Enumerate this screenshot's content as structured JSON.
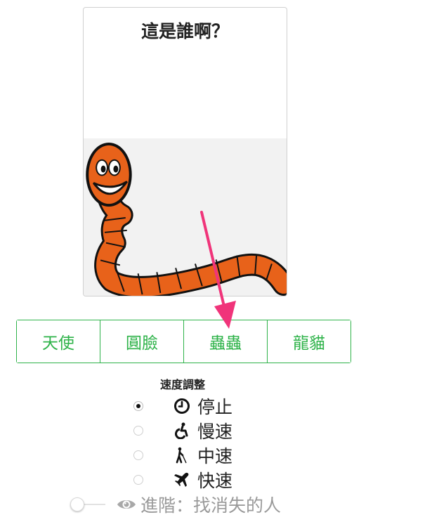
{
  "question": {
    "title": "這是誰啊？",
    "image_subject": "worm-cartoon"
  },
  "answers": [
    "天使",
    "圓臉",
    "蟲蟲",
    "龍貓"
  ],
  "speed": {
    "title": "速度調整",
    "options": [
      {
        "label": "停止",
        "icon": "clock-icon",
        "checked": true
      },
      {
        "label": "慢速",
        "icon": "wheelchair-icon",
        "checked": false
      },
      {
        "label": "中速",
        "icon": "blind-walker-icon",
        "checked": false
      },
      {
        "label": "快速",
        "icon": "airplane-icon",
        "checked": false
      }
    ]
  },
  "advanced": {
    "label": "進階：找消失的人",
    "enabled": false,
    "icon": "eye-icon"
  },
  "colors": {
    "accent": "#2fb34a",
    "arrow": "#f0347a",
    "worm": "#e8621a"
  }
}
